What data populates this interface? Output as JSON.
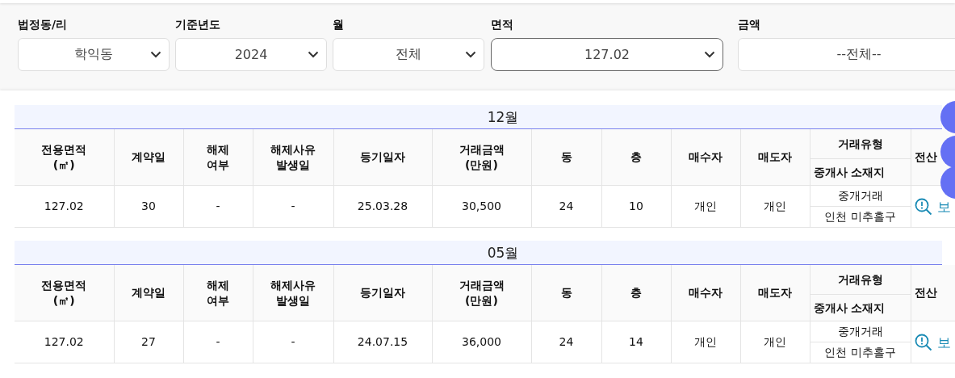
{
  "filters": [
    {
      "label": "법정동/리",
      "value": "학익동",
      "focused": false
    },
    {
      "label": "기준년도",
      "value": "2024",
      "focused": false
    },
    {
      "label": "월",
      "value": "전체",
      "focused": false
    },
    {
      "label": "면적",
      "value": "127.02",
      "focused": true
    },
    {
      "label": "금액",
      "value": "--전체--",
      "focused": false
    }
  ],
  "sections": [
    {
      "month": "12월",
      "columns": [
        {
          "kind": "text",
          "text": "전용면적\n(㎡)"
        },
        {
          "kind": "text",
          "text": "계약일"
        },
        {
          "kind": "text",
          "text": "해제\n여부"
        },
        {
          "kind": "text",
          "text": "해제사유\n발생일"
        },
        {
          "kind": "text",
          "text": "등기일자"
        },
        {
          "kind": "text",
          "text": "거래금액\n(만원)"
        },
        {
          "kind": "text",
          "text": "동"
        },
        {
          "kind": "text",
          "text": "층"
        },
        {
          "kind": "text",
          "text": "매수자"
        },
        {
          "kind": "text",
          "text": "매도자"
        },
        {
          "kind": "stacked",
          "lines": [
            "거래유형",
            "중개사 소재지"
          ]
        },
        {
          "kind": "text",
          "text": "전산"
        }
      ],
      "rows": [
        {
          "cells": [
            {
              "kind": "text",
              "text": "127.02"
            },
            {
              "kind": "text",
              "text": "30"
            },
            {
              "kind": "text",
              "text": "-"
            },
            {
              "kind": "text",
              "text": "-"
            },
            {
              "kind": "text",
              "text": "25.03.28"
            },
            {
              "kind": "text",
              "text": "30,500"
            },
            {
              "kind": "text",
              "text": "24"
            },
            {
              "kind": "text",
              "text": "10"
            },
            {
              "kind": "text",
              "text": "개인"
            },
            {
              "kind": "text",
              "text": "개인"
            },
            {
              "kind": "stacked",
              "lines": [
                "중개거래",
                "인천 미추홀구"
              ]
            },
            {
              "kind": "link",
              "text": "보"
            }
          ]
        }
      ]
    },
    {
      "month": "05월",
      "columns": [
        {
          "kind": "text",
          "text": "전용면적\n(㎡)"
        },
        {
          "kind": "text",
          "text": "계약일"
        },
        {
          "kind": "text",
          "text": "해제\n여부"
        },
        {
          "kind": "text",
          "text": "해제사유\n발생일"
        },
        {
          "kind": "text",
          "text": "등기일자"
        },
        {
          "kind": "text",
          "text": "거래금액\n(만원)"
        },
        {
          "kind": "text",
          "text": "동"
        },
        {
          "kind": "text",
          "text": "층"
        },
        {
          "kind": "text",
          "text": "매수자"
        },
        {
          "kind": "text",
          "text": "매도자"
        },
        {
          "kind": "stacked",
          "lines": [
            "거래유형",
            "중개사 소재지"
          ]
        },
        {
          "kind": "text",
          "text": "전산"
        }
      ],
      "rows": [
        {
          "cells": [
            {
              "kind": "text",
              "text": "127.02"
            },
            {
              "kind": "text",
              "text": "27"
            },
            {
              "kind": "text",
              "text": "-"
            },
            {
              "kind": "text",
              "text": "-"
            },
            {
              "kind": "text",
              "text": "24.07.15"
            },
            {
              "kind": "text",
              "text": "36,000"
            },
            {
              "kind": "text",
              "text": "24"
            },
            {
              "kind": "text",
              "text": "14"
            },
            {
              "kind": "text",
              "text": "개인"
            },
            {
              "kind": "text",
              "text": "개인"
            },
            {
              "kind": "stacked",
              "lines": [
                "중개거래",
                "인천 미추홀구"
              ]
            },
            {
              "kind": "link",
              "text": "보"
            }
          ]
        }
      ]
    }
  ]
}
